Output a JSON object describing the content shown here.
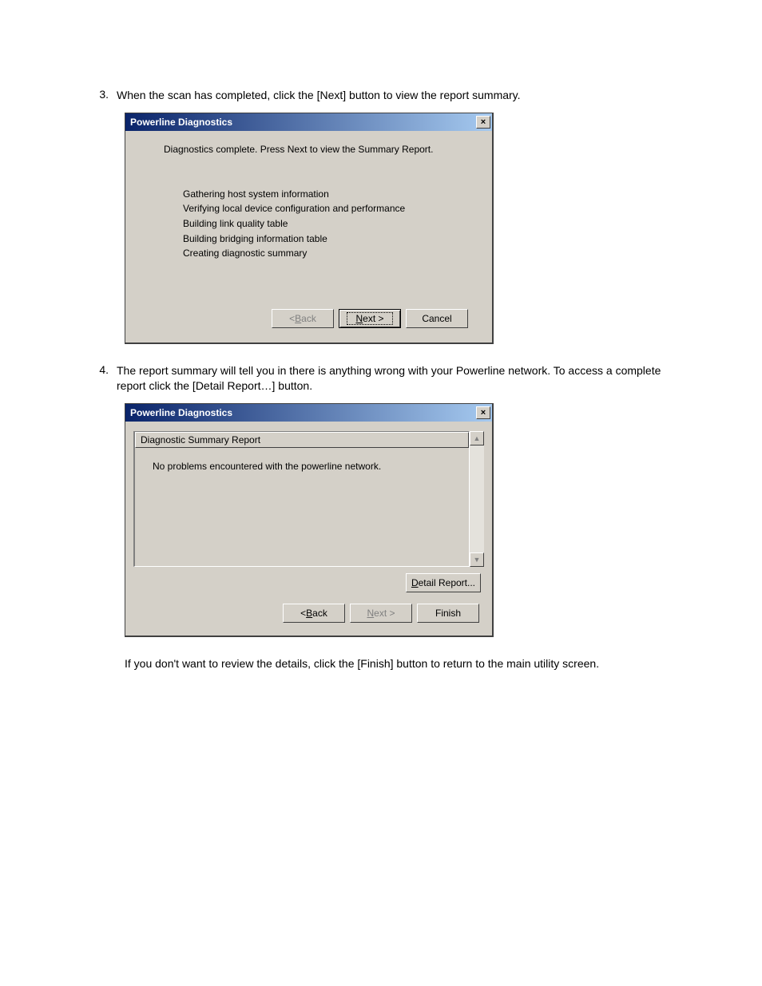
{
  "steps": {
    "num3": "3.",
    "text3": "When the scan has completed, click the [Next] button to view the report summary.",
    "num4": "4.",
    "text4": "The report summary will tell you in there is anything wrong with your Powerline network. To access a complete report click the [Detail Report…] button.",
    "trail": "If you don't want to review the details, click the [Finish] button to return to the main utility screen."
  },
  "dlg1": {
    "title": "Powerline Diagnostics",
    "close": "×",
    "status": "Diagnostics complete. Press Next to view the Summary Report.",
    "progress": {
      "l1": "Gathering host system information",
      "l2": "Verifying local device configuration and performance",
      "l3": "Building link quality table",
      "l4": "Building bridging information table",
      "l5": "Creating diagnostic summary"
    },
    "buttons": {
      "back_pre": "< ",
      "back_u": "B",
      "back_post": "ack",
      "next_u": "N",
      "next_post": "ext >",
      "cancel": "Cancel"
    }
  },
  "dlg2": {
    "title": "Powerline Diagnostics",
    "close": "×",
    "report_header": "Diagnostic Summary Report",
    "report_body": "No problems encountered with the powerline network.",
    "up": "▲",
    "down": "▼",
    "detail_u": "D",
    "detail_post": "etail Report...",
    "buttons": {
      "back_pre": "< ",
      "back_u": "B",
      "back_post": "ack",
      "next_u": "N",
      "next_post": "ext >",
      "finish": "Finish"
    }
  }
}
